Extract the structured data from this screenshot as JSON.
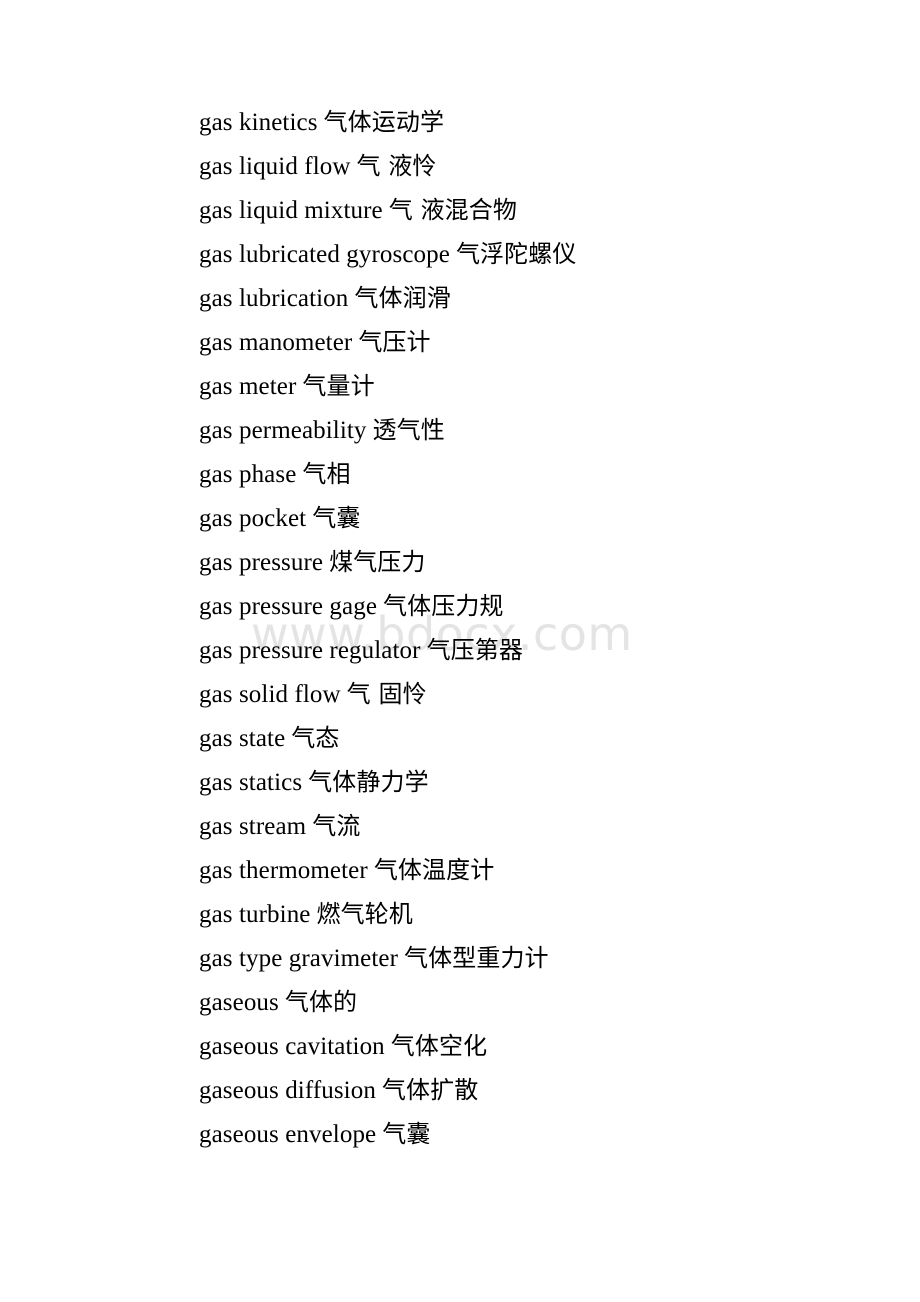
{
  "document": {
    "type": "bilingual-glossary-page",
    "page_background": "#ffffff",
    "text_color": "#000000",
    "watermark": {
      "text": "www.bdocx.com",
      "color": "#e4e4e4"
    }
  },
  "entries": [
    {
      "en": "gas kinetics",
      "zh": "气体运动学"
    },
    {
      "en": "gas liquid flow",
      "zh": "气 液怜"
    },
    {
      "en": "gas liquid mixture",
      "zh": "气 液混合物"
    },
    {
      "en": "gas lubricated gyroscope",
      "zh": "气浮陀螺仪"
    },
    {
      "en": "gas lubrication",
      "zh": "气体润滑"
    },
    {
      "en": "gas manometer",
      "zh": "气压计"
    },
    {
      "en": "gas meter",
      "zh": "气量计"
    },
    {
      "en": "gas permeability",
      "zh": "透气性"
    },
    {
      "en": "gas phase",
      "zh": "气相"
    },
    {
      "en": "gas pocket",
      "zh": "气囊"
    },
    {
      "en": "gas pressure",
      "zh": "煤气压力"
    },
    {
      "en": "gas pressure gage",
      "zh": "气体压力规"
    },
    {
      "en": "gas pressure regulator",
      "zh": "气压第器"
    },
    {
      "en": "gas solid flow",
      "zh": "气 固怜"
    },
    {
      "en": "gas state",
      "zh": "气态"
    },
    {
      "en": "gas statics",
      "zh": "气体静力学"
    },
    {
      "en": "gas stream",
      "zh": "气流"
    },
    {
      "en": "gas thermometer",
      "zh": "气体温度计"
    },
    {
      "en": "gas turbine",
      "zh": "燃气轮机"
    },
    {
      "en": "gas type gravimeter",
      "zh": "气体型重力计"
    },
    {
      "en": "gaseous",
      "zh": "气体的"
    },
    {
      "en": "gaseous cavitation",
      "zh": "气体空化"
    },
    {
      "en": "gaseous diffusion",
      "zh": "气体扩散"
    },
    {
      "en": "gaseous envelope",
      "zh": "气囊"
    }
  ]
}
